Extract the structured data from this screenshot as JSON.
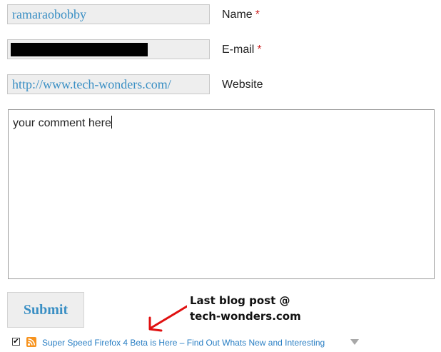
{
  "form": {
    "name": {
      "value": "ramaraobobby",
      "label": "Name",
      "required_mark": "*"
    },
    "email": {
      "value": "",
      "redacted": true,
      "label": "E-mail",
      "required_mark": "*"
    },
    "website": {
      "value": "http://www.tech-wonders.com/",
      "label": "Website"
    },
    "comment": {
      "value": "your comment here"
    },
    "submit_label": "Submit"
  },
  "annotation": {
    "line1": "Last blog post @",
    "line2": "tech-wonders.com"
  },
  "commentluv": {
    "checked": true,
    "checkbox_glyph": "✔",
    "post_title": "Super Speed Firefox 4 Beta is Here – Find Out Whats New and Interesting"
  },
  "icons": {
    "rss": "rss-icon",
    "dropdown": "chevron-down-icon",
    "arrow": "red-arrow-icon"
  },
  "colors": {
    "link": "#2a7fc4",
    "field_text": "#3a8fc4",
    "field_bg": "#eeeeee",
    "required": "#cc2222",
    "arrow": "#e01010",
    "rss": "#f7931e"
  }
}
